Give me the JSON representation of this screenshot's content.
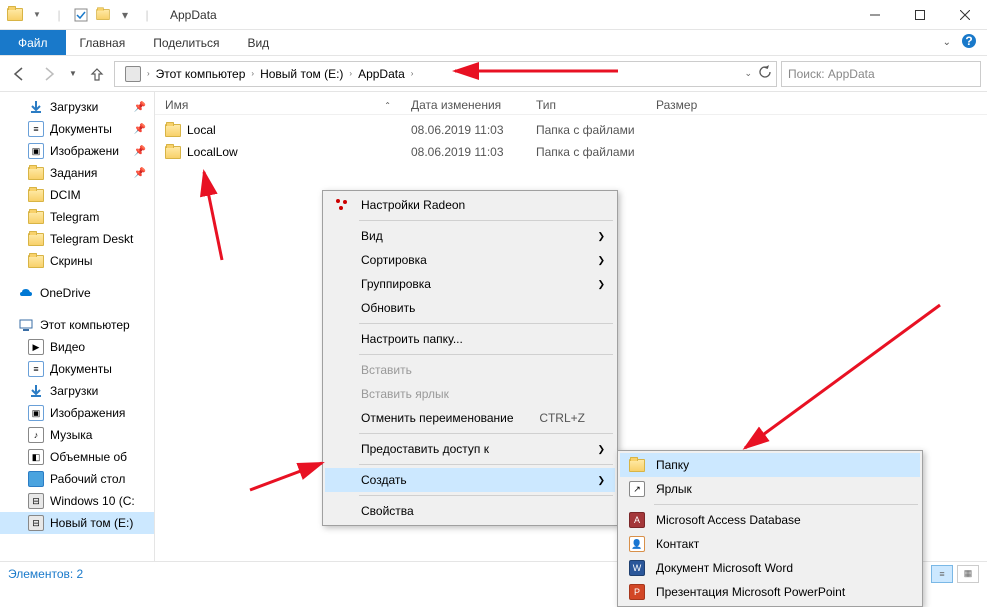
{
  "window": {
    "title": "AppData"
  },
  "ribbon": {
    "file": "Файл",
    "tabs": [
      "Главная",
      "Поделиться",
      "Вид"
    ]
  },
  "breadcrumb": {
    "items": [
      "Этот компьютер",
      "Новый том (E:)",
      "AppData"
    ]
  },
  "search": {
    "placeholder": "Поиск: AppData"
  },
  "columns": {
    "name": "Имя",
    "date": "Дата изменения",
    "type": "Тип",
    "size": "Размер"
  },
  "files": [
    {
      "name": "Local",
      "date": "08.06.2019 11:03",
      "type": "Папка с файлами"
    },
    {
      "name": "LocalLow",
      "date": "08.06.2019 11:03",
      "type": "Папка с файлами"
    }
  ],
  "sidebar": {
    "quick": [
      {
        "label": "Загрузки",
        "icon": "download",
        "pinned": true
      },
      {
        "label": "Документы",
        "icon": "doc",
        "pinned": true
      },
      {
        "label": "Изображени",
        "icon": "image",
        "pinned": true
      },
      {
        "label": "Задания",
        "icon": "folder",
        "pinned": true
      },
      {
        "label": "DCIM",
        "icon": "folder"
      },
      {
        "label": "Telegram",
        "icon": "folder"
      },
      {
        "label": "Telegram Deskt",
        "icon": "folder"
      },
      {
        "label": "Скрины",
        "icon": "folder"
      }
    ],
    "onedrive": {
      "label": "OneDrive"
    },
    "thispc": {
      "label": "Этот компьютер",
      "children": [
        {
          "label": "Видео",
          "icon": "video"
        },
        {
          "label": "Документы",
          "icon": "doc"
        },
        {
          "label": "Загрузки",
          "icon": "download"
        },
        {
          "label": "Изображения",
          "icon": "image"
        },
        {
          "label": "Музыка",
          "icon": "music"
        },
        {
          "label": "Объемные об",
          "icon": "3d"
        },
        {
          "label": "Рабочий стол",
          "icon": "desktop"
        },
        {
          "label": "Windows 10 (C:",
          "icon": "drive"
        },
        {
          "label": "Новый том (E:)",
          "icon": "drive",
          "selected": true
        }
      ]
    }
  },
  "context_menu": {
    "radeon": "Настройки Radeon",
    "view": "Вид",
    "sort": "Сортировка",
    "group": "Группировка",
    "refresh": "Обновить",
    "customize": "Настроить папку...",
    "paste": "Вставить",
    "paste_shortcut": "Вставить ярлык",
    "undo": "Отменить переименование",
    "undo_key": "CTRL+Z",
    "share": "Предоставить доступ к",
    "create": "Создать",
    "properties": "Свойства"
  },
  "create_submenu": {
    "folder": "Папку",
    "shortcut": "Ярлык",
    "access": "Microsoft Access Database",
    "contact": "Контакт",
    "word": "Документ Microsoft Word",
    "ppt": "Презентация Microsoft PowerPoint"
  },
  "status": {
    "elements": "Элементов: 2"
  }
}
